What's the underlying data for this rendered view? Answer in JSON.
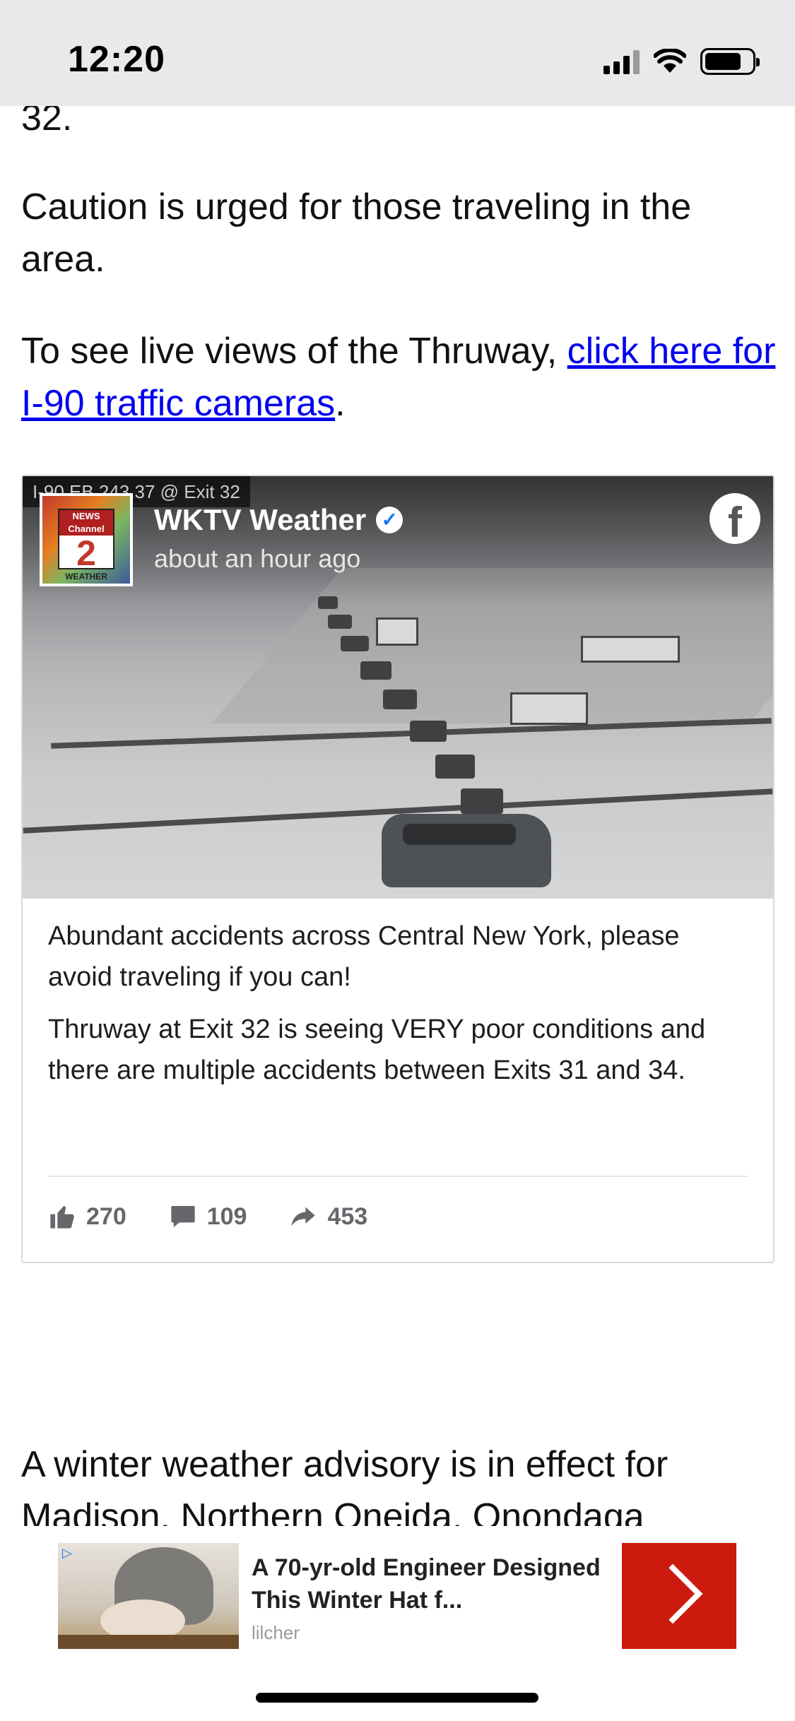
{
  "status_bar": {
    "time": "12:20"
  },
  "article": {
    "cut_line": "32.",
    "para1": "Caution is urged for those traveling in the area.",
    "para2_text": "To see live views of the Thruway, ",
    "para2_link": "click here for I-90 traffic cameras",
    "para2_end": ".",
    "para3": "A winter weather advisory is in effect for Madison, Northern Oneida, Onondaga"
  },
  "facebook_post": {
    "camera_label": "I-90 EB 243.37 @ Exit 32",
    "logo_top": "NEWS Channel",
    "logo_number": "2",
    "logo_bottom": "WEATHER",
    "page_name": "WKTV Weather",
    "verified_icon": "check",
    "time": "about an hour ago",
    "text1": "Abundant accidents across Central New York, please avoid traveling if you can!",
    "text2": "Thruway at Exit 32 is seeing VERY poor conditions and there are multiple accidents between Exits 31 and 34.",
    "likes": "270",
    "comments": "109",
    "shares": "453",
    "icons": [
      "facebook-icon",
      "like-icon",
      "comment-icon",
      "share-icon"
    ]
  },
  "ad": {
    "title": "A 70-yr-old Engineer Designed This Winter Hat f...",
    "source": "lilcher",
    "icons": [
      "ad-choice-icon",
      "chevron-right-icon"
    ],
    "cta_color": "#cc1b0e"
  }
}
